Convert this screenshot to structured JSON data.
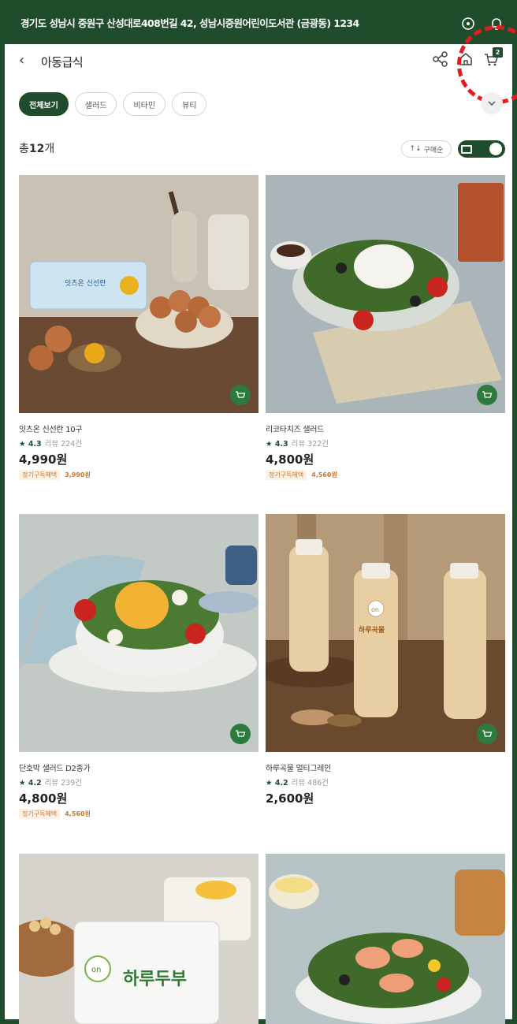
{
  "address": "경기도 성남시 중원구 산성대로408번길 42, 성남시중원어린이도서관 (금광동) 1234",
  "header": {
    "back_label": "‹",
    "title": "아동급식",
    "cart_count": "2"
  },
  "chips": [
    {
      "label": "전체보기",
      "active": true
    },
    {
      "label": "샐러드",
      "active": false
    },
    {
      "label": "비타민",
      "active": false
    },
    {
      "label": "뷰티",
      "active": false
    }
  ],
  "count": {
    "prefix": "총",
    "number": "12",
    "suffix": "개"
  },
  "sort": {
    "icon_label": "↑↓",
    "label": "구매순"
  },
  "icons": [
    "location-icon",
    "bell-icon",
    "share-icon",
    "home-icon",
    "cart-icon",
    "chevron-down-icon",
    "list-view-icon",
    "cart-add-icon",
    "star-icon"
  ],
  "colors": {
    "brand": "#1f4d2c",
    "accent_red": "#e31d1d",
    "sub_price": "#c67a2e"
  },
  "products": [
    {
      "name": "잇츠온 신선란 10구",
      "rating": "4.3",
      "reviews": "리뷰 224건",
      "price": "4,990원",
      "sub_label": "정기구독혜택",
      "sub_price": "3,990원"
    },
    {
      "name": "리코타치즈 샐러드",
      "rating": "4.3",
      "reviews": "리뷰 322건",
      "price": "4,800원",
      "sub_label": "정기구독혜택",
      "sub_price": "4,560원"
    },
    {
      "name": "단호박 샐러드 D2종가",
      "rating": "4.2",
      "reviews": "리뷰 239건",
      "price": "4,800원",
      "sub_label": "정기구독혜택",
      "sub_price": "4,560원"
    },
    {
      "name": "하루곡물 멀티그레인",
      "rating": "4.2",
      "reviews": "리뷰 486건",
      "price": "2,600원",
      "sub_label": "",
      "sub_price": ""
    },
    {
      "name": "",
      "rating": "",
      "reviews": "",
      "price": "",
      "sub_label": "",
      "sub_price": ""
    },
    {
      "name": "",
      "rating": "",
      "reviews": "",
      "price": "",
      "sub_label": "",
      "sub_price": ""
    }
  ],
  "image_text": {
    "egg_pack": "잇츠온 신선란",
    "bottle_brand": "on",
    "bottle_name": "하루곡물",
    "tofu_name": "하루두부"
  }
}
